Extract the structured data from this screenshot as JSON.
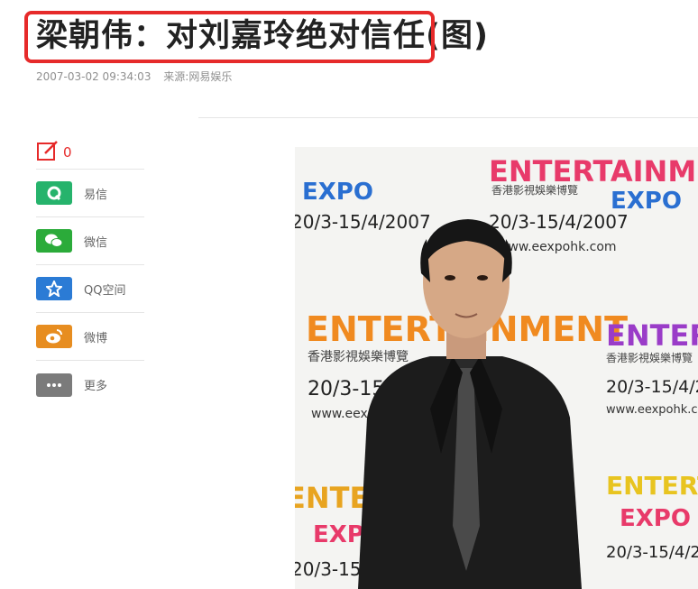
{
  "article": {
    "title": "梁朝伟：对刘嘉玲绝对信任(图)",
    "date": "2007-03-02 09:34:03",
    "source": "来源:网易娱乐"
  },
  "share": {
    "comment_count": "0",
    "items": [
      {
        "label": "易信",
        "icon": "yixin-icon",
        "color": "#26b36c"
      },
      {
        "label": "微信",
        "icon": "wechat-icon",
        "color": "#2bab3a"
      },
      {
        "label": "QQ空间",
        "icon": "qzone-icon",
        "color": "#2b7bd5"
      },
      {
        "label": "微博",
        "icon": "weibo-icon",
        "color": "#e78d20"
      },
      {
        "label": "更多",
        "icon": "more-icon",
        "color": "#7b7b7b"
      }
    ]
  },
  "photo": {
    "banner_word": "ENTERTAINMENT",
    "banner_sub": "香港影視娛樂博覽",
    "banner_expo": "EXPO",
    "banner_dates": "20/3-15/4/2007",
    "banner_url": "www.eexpohk.com"
  },
  "colors": {
    "highlight": "#e62a2a",
    "comment": "#e62a2a"
  }
}
